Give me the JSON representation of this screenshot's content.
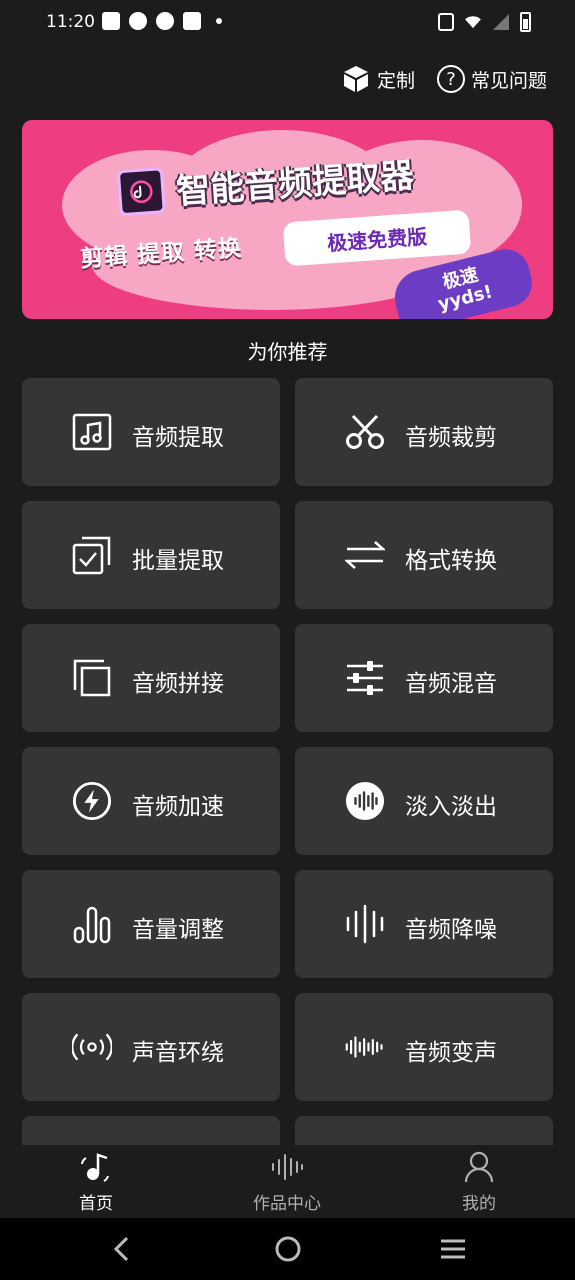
{
  "status_bar": {
    "time": "11:20",
    "left_icons": [
      "mail-icon",
      "gauge-icon",
      "gauge-icon",
      "shopping-bag-icon",
      "dot-icon"
    ],
    "right_icons": [
      "vibrate-icon",
      "wifi-icon",
      "signal-icon",
      "battery-icon"
    ]
  },
  "header": {
    "custom_label": "定制",
    "faq_label": "常见问题",
    "faq_glyph": "?",
    "notification_color": "#e53935"
  },
  "banner": {
    "title": "智能音频提取器",
    "subtitle": "剪辑 提取 转换",
    "pill": "极速免费版",
    "tag_line1": "极速",
    "tag_line2": "yyds!",
    "background_color": "#ef3d82"
  },
  "section_title": "为你推荐",
  "features": [
    {
      "label": "音频提取",
      "icon": "music-note-icon"
    },
    {
      "label": "音频裁剪",
      "icon": "scissors-icon"
    },
    {
      "label": "批量提取",
      "icon": "batch-check-icon"
    },
    {
      "label": "格式转换",
      "icon": "swap-arrows-icon"
    },
    {
      "label": "音频拼接",
      "icon": "stack-squares-icon"
    },
    {
      "label": "音频混音",
      "icon": "sliders-icon"
    },
    {
      "label": "音频加速",
      "icon": "lightning-icon"
    },
    {
      "label": "淡入淡出",
      "icon": "waveform-circle-icon"
    },
    {
      "label": "音量调整",
      "icon": "volume-bars-icon"
    },
    {
      "label": "音频降噪",
      "icon": "noise-lines-icon"
    },
    {
      "label": "声音环绕",
      "icon": "surround-icon"
    },
    {
      "label": "音频变声",
      "icon": "voice-wave-icon"
    }
  ],
  "bottom_nav": [
    {
      "label": "首页",
      "icon": "home-music-icon",
      "active": true
    },
    {
      "label": "作品中心",
      "icon": "waveform-icon",
      "active": false
    },
    {
      "label": "我的",
      "icon": "person-icon",
      "active": false
    }
  ],
  "system_nav": [
    "back-icon",
    "home-circle-icon",
    "menu-icon"
  ]
}
